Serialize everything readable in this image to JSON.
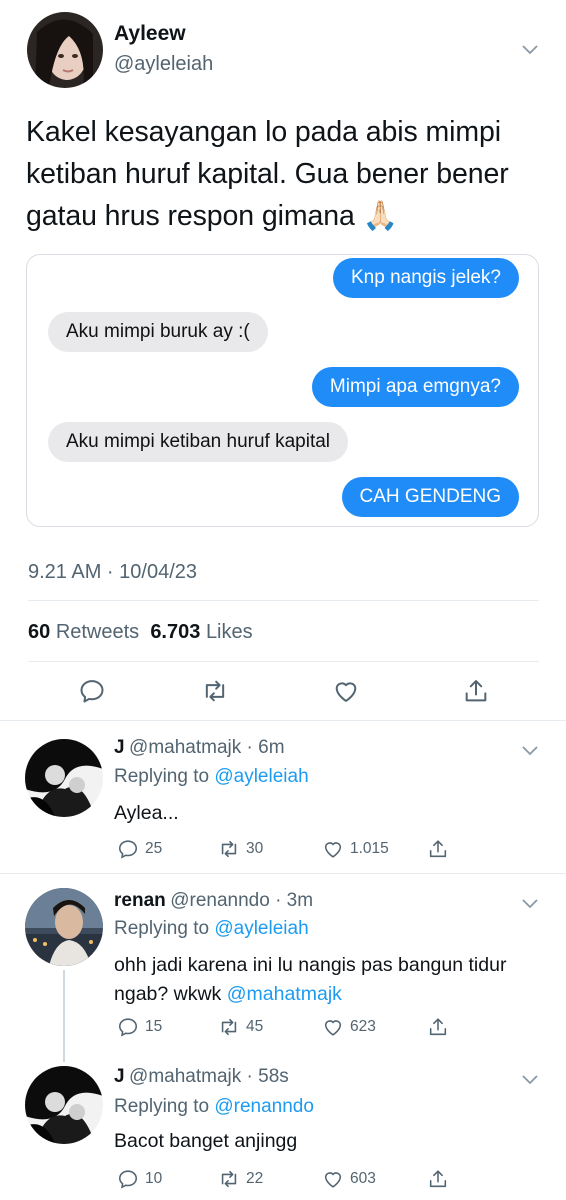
{
  "tweet": {
    "name": "Ayleew",
    "handle": "@ayleleiah",
    "text_lines": [
      "Kakel kesayangan lo pada abis mimpi",
      "ketiban huruf kapital. Gua bener bener",
      "gatau hrus respon gimana 🙏🏻"
    ],
    "messages": [
      {
        "side": "right",
        "text": "Knp nangis jelek?"
      },
      {
        "side": "left",
        "text": "Aku mimpi buruk ay :("
      },
      {
        "side": "right",
        "text": "Mimpi apa emgnya?"
      },
      {
        "side": "left",
        "text": "Aku mimpi ketiban huruf kapital"
      },
      {
        "side": "right",
        "text": "CAH GENDENG"
      }
    ],
    "timestamp": "9.21 AM · 10/04/23",
    "retweets_count": "60",
    "retweets_label": "Retweets",
    "likes_count": "6.703",
    "likes_label": "Likes",
    "icons": [
      "reply-icon",
      "retweet-icon",
      "like-icon",
      "share-icon"
    ]
  },
  "replies": [
    {
      "name": "J",
      "handle_time": "@mahatmajk · 6m",
      "replying_prefix": "Replying to",
      "replying_to": "@ayleleiah",
      "text": "Aylea...",
      "text_mention": "",
      "replies": "25",
      "retweets": "30",
      "likes": "1.015"
    },
    {
      "name": "renan",
      "handle_time": "@renanndo · 3m",
      "replying_prefix": "Replying to",
      "replying_to": "@ayleleiah",
      "text": "ohh jadi karena ini lu nangis pas bangun tidur ngab? wkwk",
      "text_mention": "@mahatmajk",
      "replies": "15",
      "retweets": "45",
      "likes": "623"
    },
    {
      "name": "J",
      "handle_time": "@mahatmajk · 58s",
      "replying_prefix": "Replying to",
      "replying_to": "@renanndo",
      "text": "Bacot banget anjingg",
      "text_mention": "",
      "replies": "10",
      "retweets": "22",
      "likes": "603"
    }
  ],
  "colors": {
    "accent": "#1d9bf0",
    "imessage_blue": "#1f8cf7",
    "imessage_gray": "#e9e9eb",
    "secondary_text": "#536471"
  }
}
